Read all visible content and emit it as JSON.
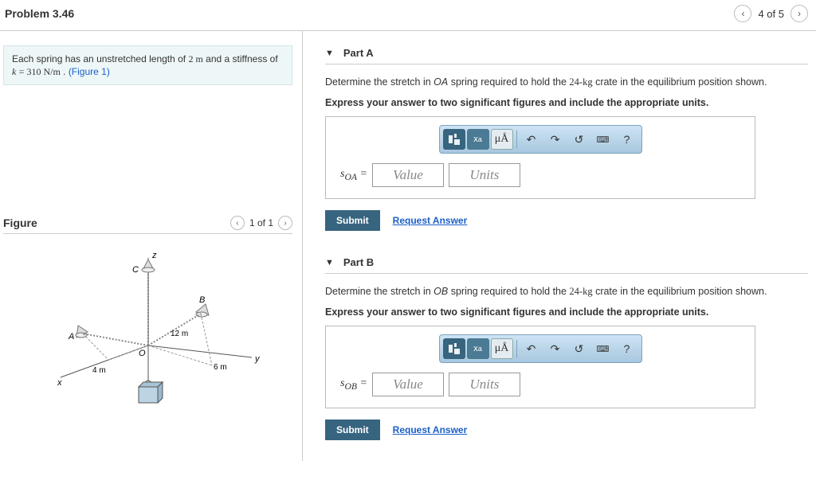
{
  "header": {
    "title": "Problem 3.46",
    "page_text": "4 of 5"
  },
  "problem": {
    "text_prefix": "Each spring has an unstretched length of ",
    "length": "2 m",
    "text_mid": " and a stiffness of ",
    "k_var": "k",
    "k_val": "= 310 N/m",
    "text_suffix": " .",
    "figure_link": "(Figure 1)"
  },
  "figure": {
    "title": "Figure",
    "page_text": "1 of 1",
    "labels": {
      "z": "z",
      "c": "C",
      "b": "B",
      "a": "A",
      "o": "O",
      "x": "x",
      "y": "y",
      "d12": "12 m",
      "d6": "6 m",
      "d4": "4 m"
    }
  },
  "parts": {
    "a": {
      "name": "Part A",
      "prompt_lead": "Determine the stretch in ",
      "prompt_spring": "OA",
      "prompt_mid": " spring required to hold the ",
      "mass": "24-kg",
      "prompt_end": " crate in the equilibrium position shown.",
      "instruct": "Express your answer to two significant figures and include the appropriate units.",
      "var_name": "sOA =",
      "value_ph": "Value",
      "units_ph": "Units",
      "submit": "Submit",
      "request": "Request Answer",
      "mu_label": "μÅ"
    },
    "b": {
      "name": "Part B",
      "prompt_lead": "Determine the stretch in ",
      "prompt_spring": "OB",
      "prompt_mid": " spring required to hold the ",
      "mass": "24-kg",
      "prompt_end": " crate in the equilibrium position shown.",
      "instruct": "Express your answer to two significant figures and include the appropriate units.",
      "var_name": "sOB =",
      "value_ph": "Value",
      "units_ph": "Units",
      "submit": "Submit",
      "request": "Request Answer",
      "mu_label": "μÅ"
    }
  }
}
